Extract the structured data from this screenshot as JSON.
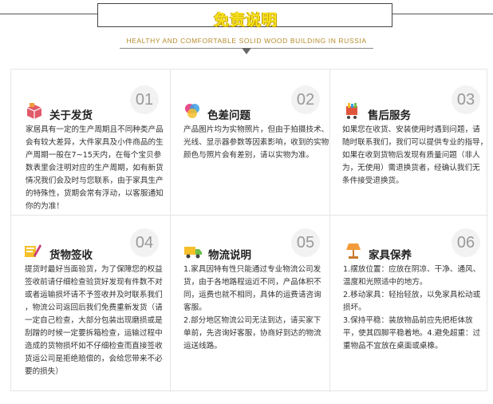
{
  "header": {
    "title": "免责说明",
    "subtitle": "HEALTHY AND COMFORTABLE SOLID WOOD BUILDING IN RUSSIA"
  },
  "cards": [
    {
      "number": "01",
      "title": "关于发货",
      "icon": "shipping-box-icon",
      "lines": [
        "家居具有一定的生产周期且不同种类产品",
        "会有较大差异，大件家具及小件商品的生",
        "产周期一般在7~15天内，在每个宝贝参",
        "数表里会注明对应的生产周期，如有新货",
        "情况我们会及时与您联系，由于家具生产",
        "的特殊性，货期会常有浮动，以客服通知",
        "你的为准！"
      ]
    },
    {
      "number": "02",
      "title": "色差问题",
      "icon": "color-palette-icon",
      "lines": [
        "产品图片均为实物照片，但由于拍摄技术、",
        "光线、显示器参数等因素影响，收到的实物",
        "颜色与照片会有差别，请以实物为准。"
      ]
    },
    {
      "number": "03",
      "title": "售后服务",
      "icon": "service-cart-icon",
      "lines": [
        "如果您在收货、安装使用时遇到问题，请",
        "随时联系我们，我们可以提供专业的指导，",
        "如果在收到货物后发现有质量问题（非人",
        "为，无使用）需退换货者，经确认我们无",
        "条件接受退换货。"
      ]
    },
    {
      "number": "04",
      "title": "货物签收",
      "icon": "sign-pen-icon",
      "lines": [
        "提货时最好当面验货，为了保障您的权益",
        "签收前请仔细检查验货好发现有件数不对",
        "或者运输损坏请不予签收并及时联系我们",
        "，物流公司返回后我们免费重新发货（请",
        "一定自己检查，大部分包装出现磨损或是",
        "刮蹭的时候一定要拆箱检查，运输过程中",
        "造成的货物损坏如不仔细检查而直接签收",
        "货运公司是拒绝赔偿的，会给您带来不必",
        "要的损失）"
      ]
    },
    {
      "number": "05",
      "title": "物流说明",
      "icon": "delivery-truck-icon",
      "lines": [
        "1.家具因特有性只能通过专业物流公司发",
        "货，由于各地路程运近不同，产品体积不",
        "同，运费也就不相同，具体的运费请咨询",
        "客服。",
        "2.部分地区物流公司无法到达，请买家下",
        "单前，先咨询好客服，协商好到达的物流",
        "运送线路。"
      ]
    },
    {
      "number": "06",
      "title": "家具保养",
      "icon": "table-lamp-icon",
      "lines": [
        "1.摆放位置：应放在阴凉、干净、通风、",
        "温度和光照适中的地方。",
        "2.移动家具：轻抬轻放，以免家具松动或",
        "损坏。",
        "3.保持平稳：装放物品前应先把柜体放",
        "平，使其四脚平稳着地。4.避免超重：过",
        "重物品不宜放在桌面或桌橡。"
      ]
    }
  ]
}
